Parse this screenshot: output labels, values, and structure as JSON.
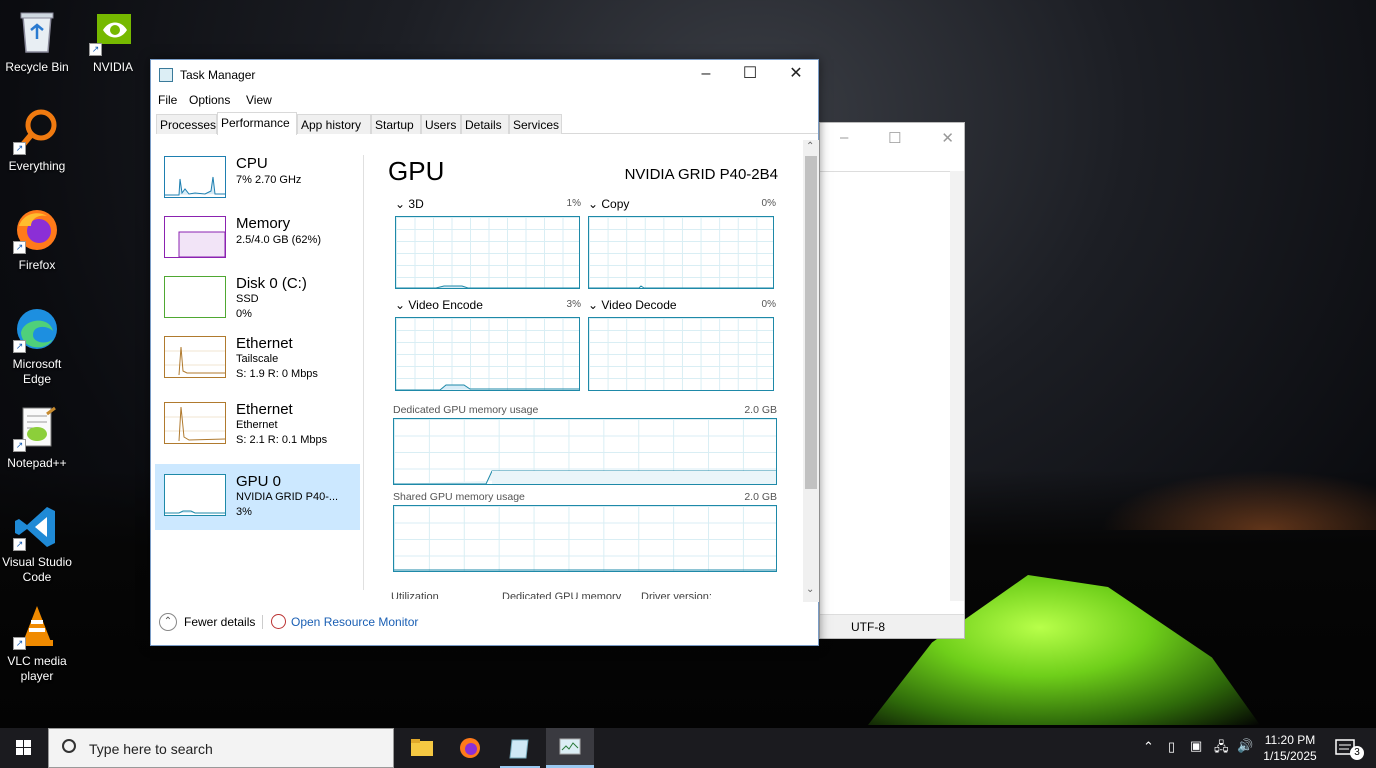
{
  "desktop": {
    "icons": [
      {
        "label": "Recycle Bin",
        "icon": "recycle-bin-icon"
      },
      {
        "label": "NVIDIA",
        "icon": "nvidia-icon"
      },
      {
        "label": "Everything",
        "icon": "everything-icon"
      },
      {
        "label": "Firefox",
        "icon": "firefox-icon"
      },
      {
        "label": "Microsoft Edge",
        "icon": "edge-icon"
      },
      {
        "label": "Notepad++",
        "icon": "notepadpp-icon"
      },
      {
        "label": "Visual Studio Code",
        "icon": "vscode-icon"
      },
      {
        "label": "VLC media player",
        "icon": "vlc-icon"
      }
    ]
  },
  "background_window": {
    "encoding": "UTF-8"
  },
  "task_manager": {
    "title": "Task Manager",
    "menu": [
      "File",
      "Options",
      "View"
    ],
    "tabs": [
      "Processes",
      "Performance",
      "App history",
      "Startup",
      "Users",
      "Details",
      "Services"
    ],
    "active_tab": "Performance",
    "sidebar": [
      {
        "name": "CPU",
        "line1": "7% 2.70 GHz",
        "line2": "",
        "color": "#1e7fb0"
      },
      {
        "name": "Memory",
        "line1": "2.5/4.0 GB (62%)",
        "line2": "",
        "color": "#8b22b0"
      },
      {
        "name": "Disk 0 (C:)",
        "line1": "SSD",
        "line2": "0%",
        "color": "#4fa832"
      },
      {
        "name": "Ethernet",
        "line1": "Tailscale",
        "line2": "S: 1.9 R: 0 Mbps",
        "color": "#b07a2e"
      },
      {
        "name": "Ethernet",
        "line1": "Ethernet",
        "line2": "S: 2.1 R: 0.1 Mbps",
        "color": "#b07a2e"
      },
      {
        "name": "GPU 0",
        "line1": "NVIDIA GRID P40-...",
        "line2": "3%",
        "color": "#1e89a8"
      }
    ],
    "gpu": {
      "title": "GPU",
      "model": "NVIDIA GRID P40-2B4",
      "engines": [
        {
          "label": "3D",
          "value": "1%"
        },
        {
          "label": "Copy",
          "value": "0%"
        },
        {
          "label": "Video Encode",
          "value": "3%"
        },
        {
          "label": "Video Decode",
          "value": "0%"
        }
      ],
      "dedicated_label": "Dedicated GPU memory usage",
      "dedicated_max": "2.0 GB",
      "shared_label": "Shared GPU memory usage",
      "shared_max": "2.0 GB",
      "bottom_labels": [
        "Utilization",
        "Dedicated GPU memory",
        "Driver version:"
      ]
    },
    "footer": {
      "fewer_details": "Fewer details",
      "open_resource_monitor": "Open Resource Monitor"
    }
  },
  "taskbar": {
    "search_placeholder": "Type here to search",
    "time": "11:20 PM",
    "date": "1/15/2025",
    "notification_count": "3"
  }
}
